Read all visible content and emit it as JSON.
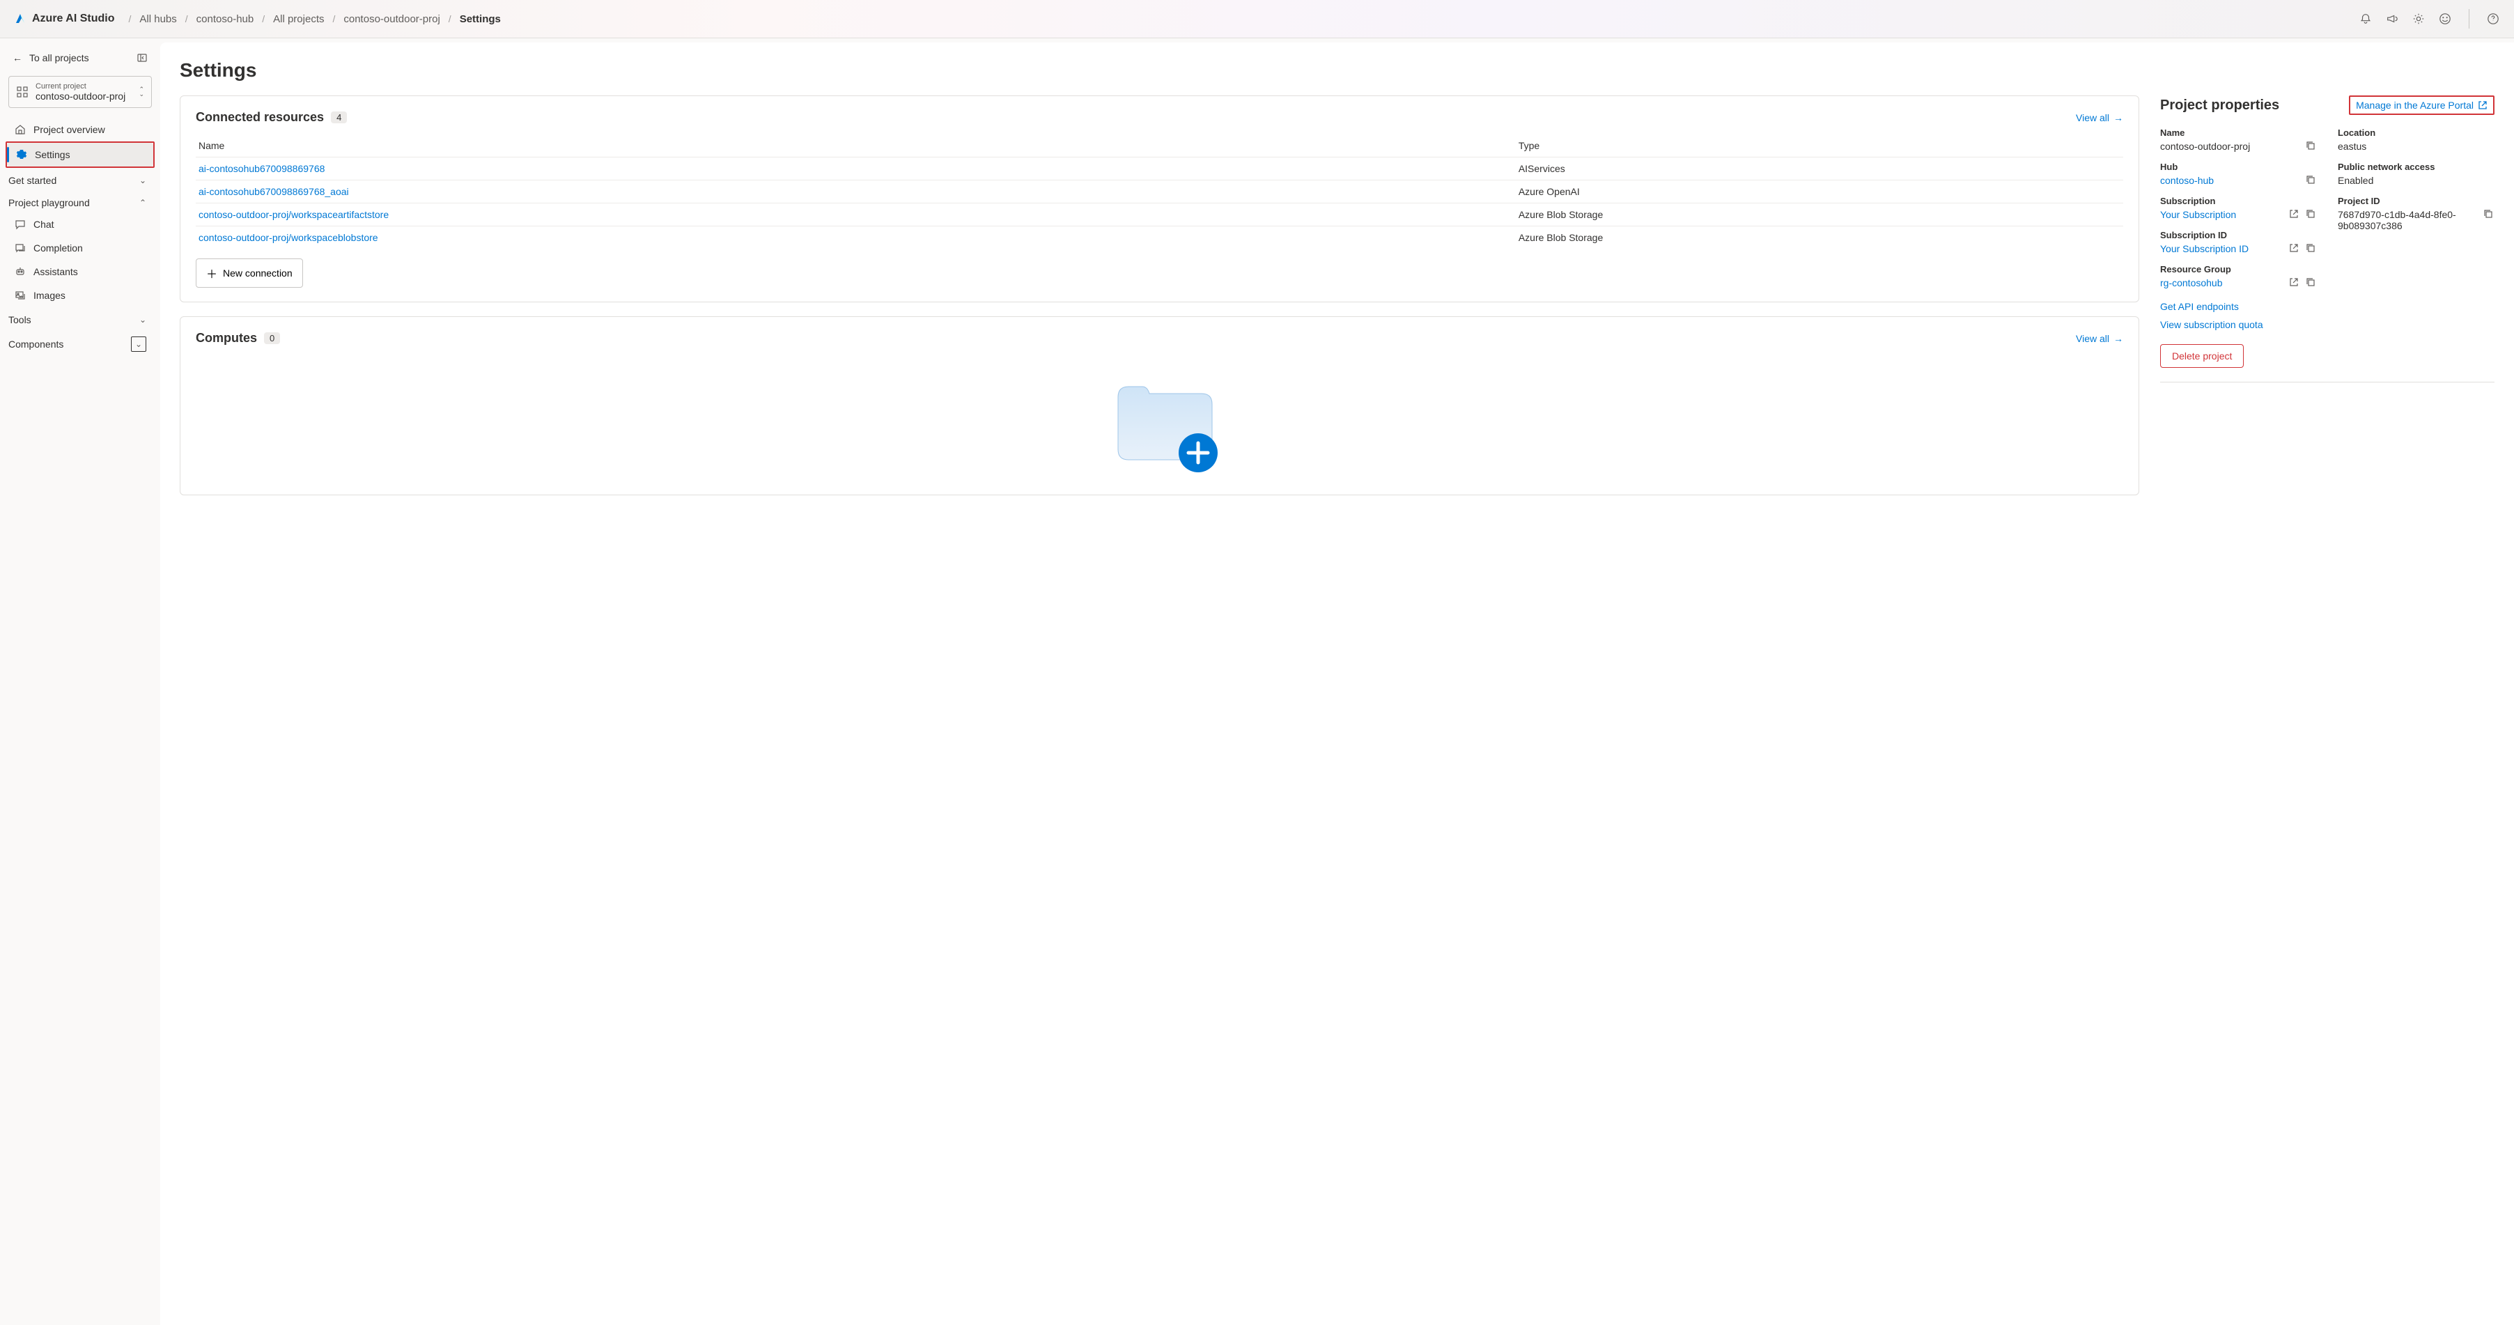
{
  "app_name": "Azure AI Studio",
  "breadcrumbs": [
    "All hubs",
    "contoso-hub",
    "All projects",
    "contoso-outdoor-proj",
    "Settings"
  ],
  "sidebar": {
    "back_link": "To all projects",
    "project_selector": {
      "label": "Current project",
      "name": "contoso-outdoor-proj"
    },
    "nav": {
      "overview": "Project overview",
      "settings": "Settings"
    },
    "groups": {
      "get_started": "Get started",
      "playground": "Project playground",
      "tools": "Tools",
      "components": "Components"
    },
    "playground_items": {
      "chat": "Chat",
      "completion": "Completion",
      "assistants": "Assistants",
      "images": "Images"
    }
  },
  "page": {
    "title": "Settings",
    "connected": {
      "title": "Connected resources",
      "count": "4",
      "view_all": "View all",
      "col_name": "Name",
      "col_type": "Type",
      "rows": [
        {
          "name": "ai-contosohub670098869768",
          "type": "AIServices"
        },
        {
          "name": "ai-contosohub670098869768_aoai",
          "type": "Azure OpenAI"
        },
        {
          "name": "contoso-outdoor-proj/workspaceartifactstore",
          "type": "Azure Blob Storage"
        },
        {
          "name": "contoso-outdoor-proj/workspaceblobstore",
          "type": "Azure Blob Storage"
        }
      ],
      "new_btn": "New connection"
    },
    "computes": {
      "title": "Computes",
      "count": "0",
      "view_all": "View all"
    },
    "properties": {
      "title": "Project properties",
      "manage_link": "Manage in the Azure Portal",
      "left": {
        "name_label": "Name",
        "name_value": "contoso-outdoor-proj",
        "hub_label": "Hub",
        "hub_value": "contoso-hub",
        "sub_label": "Subscription",
        "sub_value": "Your Subscription",
        "subid_label": "Subscription ID",
        "subid_value": "Your Subscription ID",
        "rg_label": "Resource Group",
        "rg_value": "rg-contosohub"
      },
      "right": {
        "loc_label": "Location",
        "loc_value": "eastus",
        "net_label": "Public network access",
        "net_value": "Enabled",
        "pid_label": "Project ID",
        "pid_value": "7687d970-c1db-4a4d-8fe0-9b089307c386"
      },
      "get_api": "Get API endpoints",
      "view_quota": "View subscription quota",
      "delete": "Delete project"
    }
  }
}
